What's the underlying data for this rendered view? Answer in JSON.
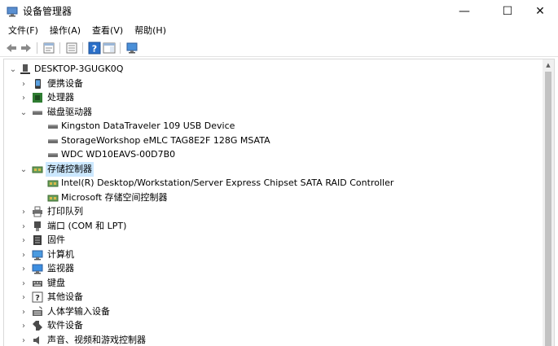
{
  "window": {
    "title": "设备管理器",
    "min_glyph": "—",
    "max_glyph": "☐",
    "close_glyph": "✕"
  },
  "menu": [
    "文件(F)",
    "操作(A)",
    "查看(V)",
    "帮助(H)"
  ],
  "toolbar": {
    "buttons": [
      "back-arrow-icon",
      "forward-arrow-icon",
      "properties-icon",
      "show-hidden-icon",
      "help-icon",
      "action-pane-icon",
      "monitor-icon"
    ]
  },
  "tree": {
    "root": "DESKTOP-3GUGK0Q",
    "categories": [
      {
        "label": "便携设备",
        "icon": "portable-device-icon",
        "expanded": false
      },
      {
        "label": "处理器",
        "icon": "processor-icon",
        "expanded": false
      },
      {
        "label": "磁盘驱动器",
        "icon": "disk-drive-icon",
        "expanded": true,
        "children": [
          "Kingston DataTraveler 109 USB Device",
          "StorageWorkshop eMLC TAG8E2F 128G MSATA",
          "WDC WD10EAVS-00D7B0"
        ]
      },
      {
        "label": "存储控制器",
        "icon": "storage-controller-icon",
        "expanded": true,
        "selected": true,
        "children": [
          "Intel(R) Desktop/Workstation/Server Express Chipset SATA RAID Controller",
          "Microsoft 存储空间控制器"
        ]
      },
      {
        "label": "打印队列",
        "icon": "printer-icon",
        "expanded": false
      },
      {
        "label": "端口 (COM 和 LPT)",
        "icon": "port-icon",
        "expanded": false
      },
      {
        "label": "固件",
        "icon": "firmware-icon",
        "expanded": false
      },
      {
        "label": "计算机",
        "icon": "computer-icon",
        "expanded": false
      },
      {
        "label": "监视器",
        "icon": "monitor-icon",
        "expanded": false
      },
      {
        "label": "键盘",
        "icon": "keyboard-icon",
        "expanded": false
      },
      {
        "label": "其他设备",
        "icon": "other-device-icon",
        "expanded": false
      },
      {
        "label": "人体学输入设备",
        "icon": "hid-icon",
        "expanded": false
      },
      {
        "label": "软件设备",
        "icon": "software-device-icon",
        "expanded": false
      },
      {
        "label": "声音、视频和游戏控制器",
        "icon": "sound-icon",
        "expanded": false
      }
    ]
  },
  "colors": {
    "selection": "#cce8ff",
    "chevron": "#555555",
    "scroll_track": "#f0f0f0",
    "scroll_thumb": "#c2c2c2"
  }
}
